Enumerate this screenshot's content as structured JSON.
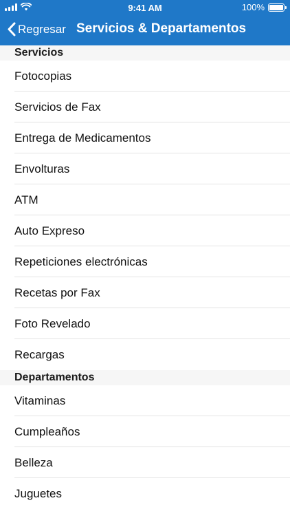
{
  "status_bar": {
    "time": "9:41 AM",
    "battery": "100%",
    "battery_level": 1.0
  },
  "nav": {
    "back_label": "Regresar",
    "title": "Servicios & Departamentos"
  },
  "sections": [
    {
      "title": "Servicios",
      "items": [
        "Fotocopias",
        "Servicios de Fax",
        "Entrega de Medicamentos",
        "Envolturas",
        "ATM",
        "Auto Expreso",
        "Repeticiones electrónicas",
        "Recetas por Fax",
        "Foto Revelado",
        "Recargas"
      ]
    },
    {
      "title": "Departamentos",
      "items": [
        "Vitaminas",
        "Cumpleaños",
        "Belleza",
        "Juguetes"
      ]
    }
  ],
  "colors": {
    "nav_background": "#1f78c8",
    "section_background": "#f6f6f6"
  }
}
